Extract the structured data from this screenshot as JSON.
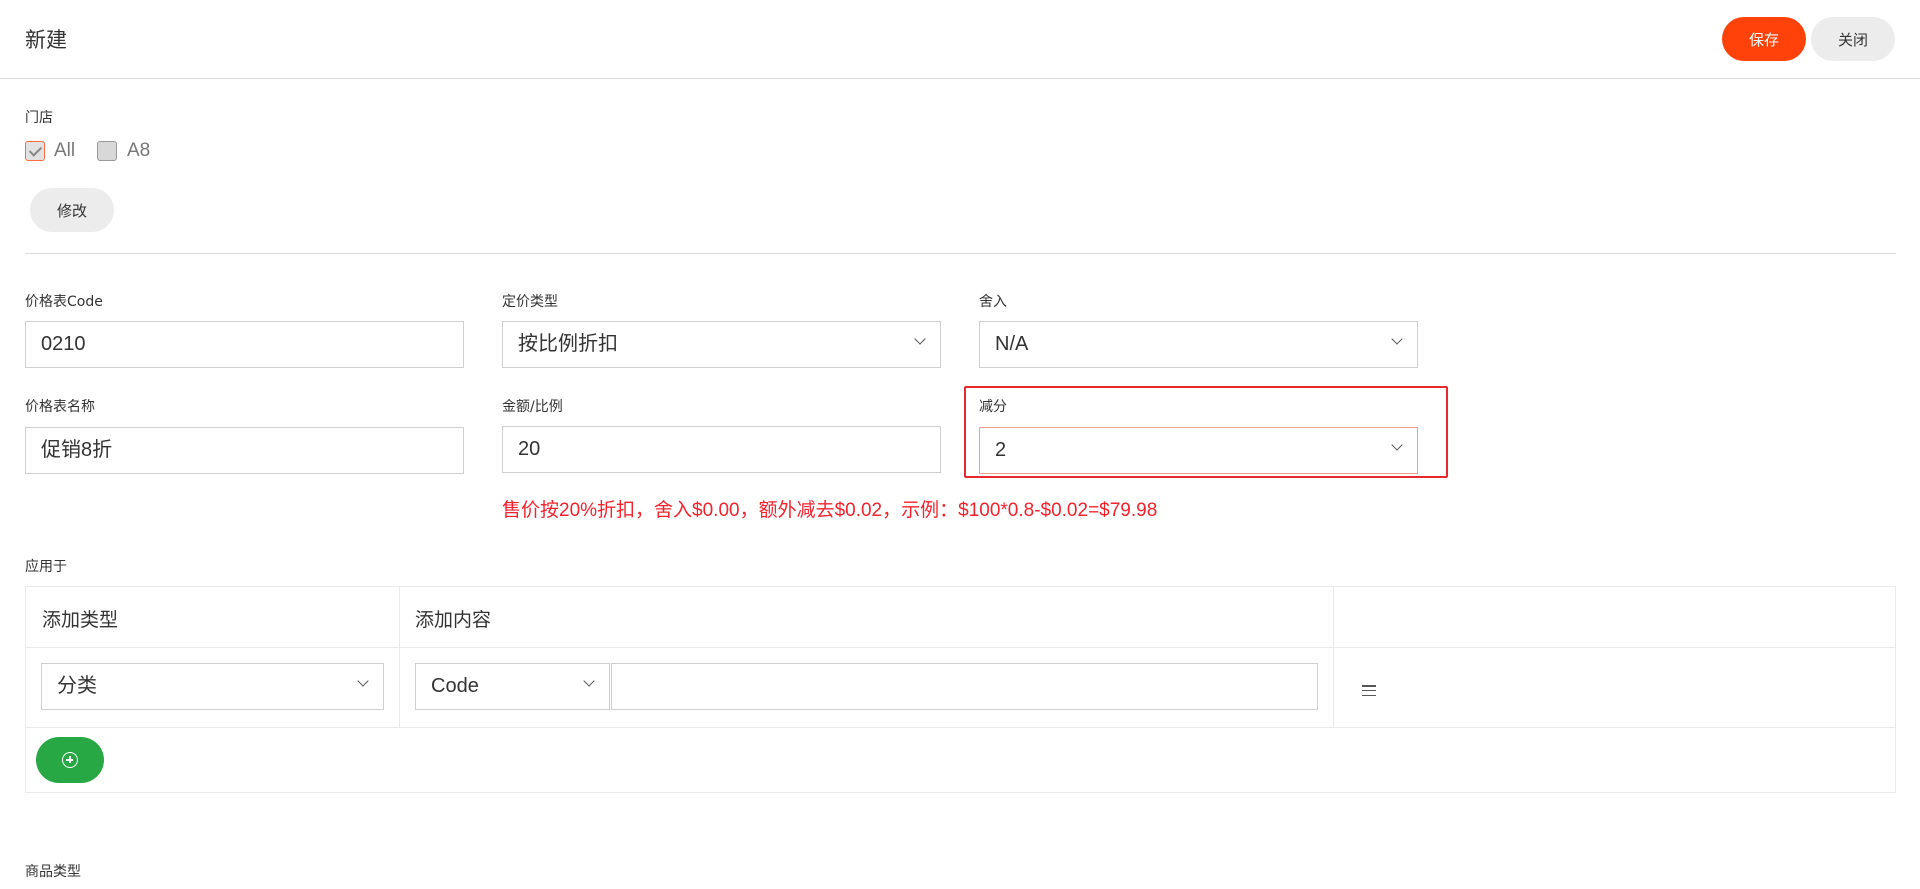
{
  "header": {
    "title": "新建",
    "save_label": "保存",
    "close_label": "关闭"
  },
  "store": {
    "label": "门店",
    "options": [
      {
        "label": "All",
        "checked": true
      },
      {
        "label": "A8",
        "checked": false
      }
    ],
    "modify_label": "修改"
  },
  "form": {
    "price_code": {
      "label": "价格表Code",
      "value": "0210"
    },
    "pricing_type": {
      "label": "定价类型",
      "value": "按比例折扣"
    },
    "rounding": {
      "label": "舍入",
      "value": "N/A"
    },
    "price_name": {
      "label": "价格表名称",
      "value": "促销8折"
    },
    "amount_ratio": {
      "label": "金额/比例",
      "value": "20"
    },
    "deduction": {
      "label": "减分",
      "value": "2"
    }
  },
  "info_text": "售价按20%折扣，舍入$0.00，额外减去$0.02，示例：$100*0.8-$0.02=$79.98",
  "apply_to": {
    "label": "应用于",
    "columns": [
      "添加类型",
      "添加内容",
      ""
    ],
    "rows": [
      {
        "type": "分类",
        "content_field": "Code",
        "content_value": ""
      }
    ]
  },
  "product_type": {
    "label": "商品类型"
  },
  "colors": {
    "accent": "#ff4209",
    "add": "#28a745",
    "alert": "#f5222d"
  }
}
